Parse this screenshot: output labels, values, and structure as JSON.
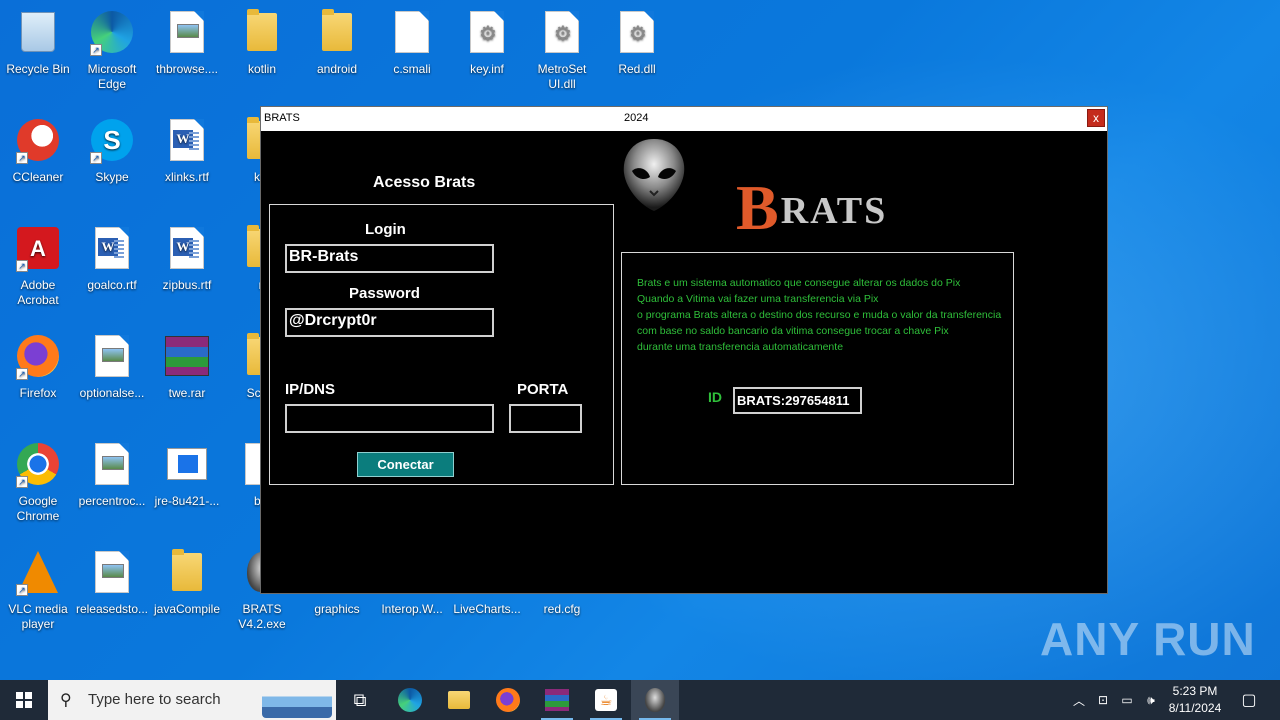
{
  "desktop": {
    "icons": [
      {
        "label": "Recycle Bin"
      },
      {
        "label": "Microsoft Edge"
      },
      {
        "label": "thbrowse...."
      },
      {
        "label": "kotlin"
      },
      {
        "label": "android"
      },
      {
        "label": "c.smali"
      },
      {
        "label": "key.inf"
      },
      {
        "label": "MetroSet UI.dll"
      },
      {
        "label": "Red.dll"
      },
      {
        "label": "CCleaner"
      },
      {
        "label": "Skype"
      },
      {
        "label": "xlinks.rtf"
      },
      {
        "label": "kot"
      },
      {
        "label": "Adobe Acrobat"
      },
      {
        "label": "goalco.rtf"
      },
      {
        "label": "zipbus.rtf"
      },
      {
        "label": "n"
      },
      {
        "label": "Firefox"
      },
      {
        "label": "optionalse..."
      },
      {
        "label": "twe.rar"
      },
      {
        "label": "Script"
      },
      {
        "label": "Google Chrome"
      },
      {
        "label": "percentroc..."
      },
      {
        "label": "jre-8u421-..."
      },
      {
        "label": "b.s"
      },
      {
        "label": "VLC media player"
      },
      {
        "label": "releasedsto..."
      },
      {
        "label": "javaCompile"
      },
      {
        "label": "BRATS V4.2.exe"
      },
      {
        "label": "graphics"
      },
      {
        "label": "Interop.W..."
      },
      {
        "label": "LiveCharts..."
      },
      {
        "label": "red.cfg"
      }
    ]
  },
  "window": {
    "title": "BRATS",
    "year": "2024",
    "close_label": "x",
    "heading": "Acesso Brats",
    "login_label": "Login",
    "login_value": "BR-Brats",
    "password_label": "Password",
    "password_value": "@Drcrypt0r",
    "ipdns_label": "IP/DNS",
    "ipdns_value": "",
    "porta_label": "PORTA",
    "porta_value": "",
    "connect_label": "Conectar",
    "brand_initial": "B",
    "brand_rest": "RATS",
    "info_lines": [
      "Brats e um sistema automatico que consegue alterar os dados do Pix",
      "Quando a Vitima vai fazer uma transferencia via Pix",
      "o programa Brats altera o destino  dos recurso e muda o valor da transferencia",
      "com base no saldo bancario da vitima  consegue trocar a chave Pix",
      "durante uma transferencia automaticamente"
    ],
    "id_label": "ID",
    "id_value": "BRATS:297654811"
  },
  "watermark": "ANY RUN",
  "taskbar": {
    "search_placeholder": "Type here to search",
    "time": "5:23 PM",
    "date": "8/11/2024"
  },
  "colors": {
    "desktop_blue": "#0a78dc",
    "window_bg": "#000000",
    "info_green": "#2fbf3a",
    "connect_teal": "#0b7d7d",
    "brand_orange": "#e05a2a",
    "close_red": "#c42b1c"
  }
}
